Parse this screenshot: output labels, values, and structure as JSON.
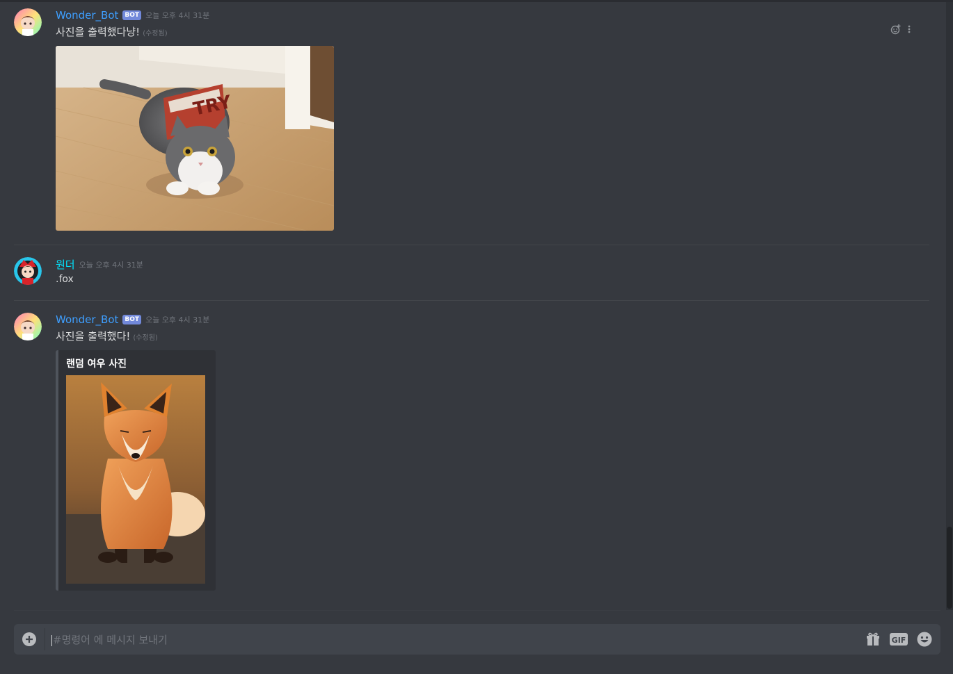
{
  "messages": [
    {
      "username": "Wonder_Bot",
      "bot_tag": "BOT",
      "timestamp": "오늘 오후 4시 31분",
      "text": "사진을 출력했다냥!",
      "edited": "(수정됨)",
      "attachment_icon": "cat-photo"
    },
    {
      "username": "원더",
      "timestamp": "오늘 오후 4시 31분",
      "text": ".fox"
    },
    {
      "username": "Wonder_Bot",
      "bot_tag": "BOT",
      "timestamp": "오늘 오후 4시 31분",
      "text": "사진을 출력했다!",
      "edited": "(수정됨)",
      "embed": {
        "title": "랜덤 여우 사진",
        "image_icon": "fox-photo"
      }
    }
  ],
  "input": {
    "placeholder": "#명령어 에 메시지 보내기"
  },
  "colors": {
    "bot_name": "#3e9fff",
    "user_name": "#00e5ff",
    "bot_tag_bg": "#7289da",
    "background": "#36393f"
  },
  "icons": {
    "add": "plus-circle-icon",
    "gift": "gift-icon",
    "gif": "gif-icon",
    "emoji": "emoji-icon",
    "reaction": "add-reaction-icon",
    "more": "more-icon"
  }
}
